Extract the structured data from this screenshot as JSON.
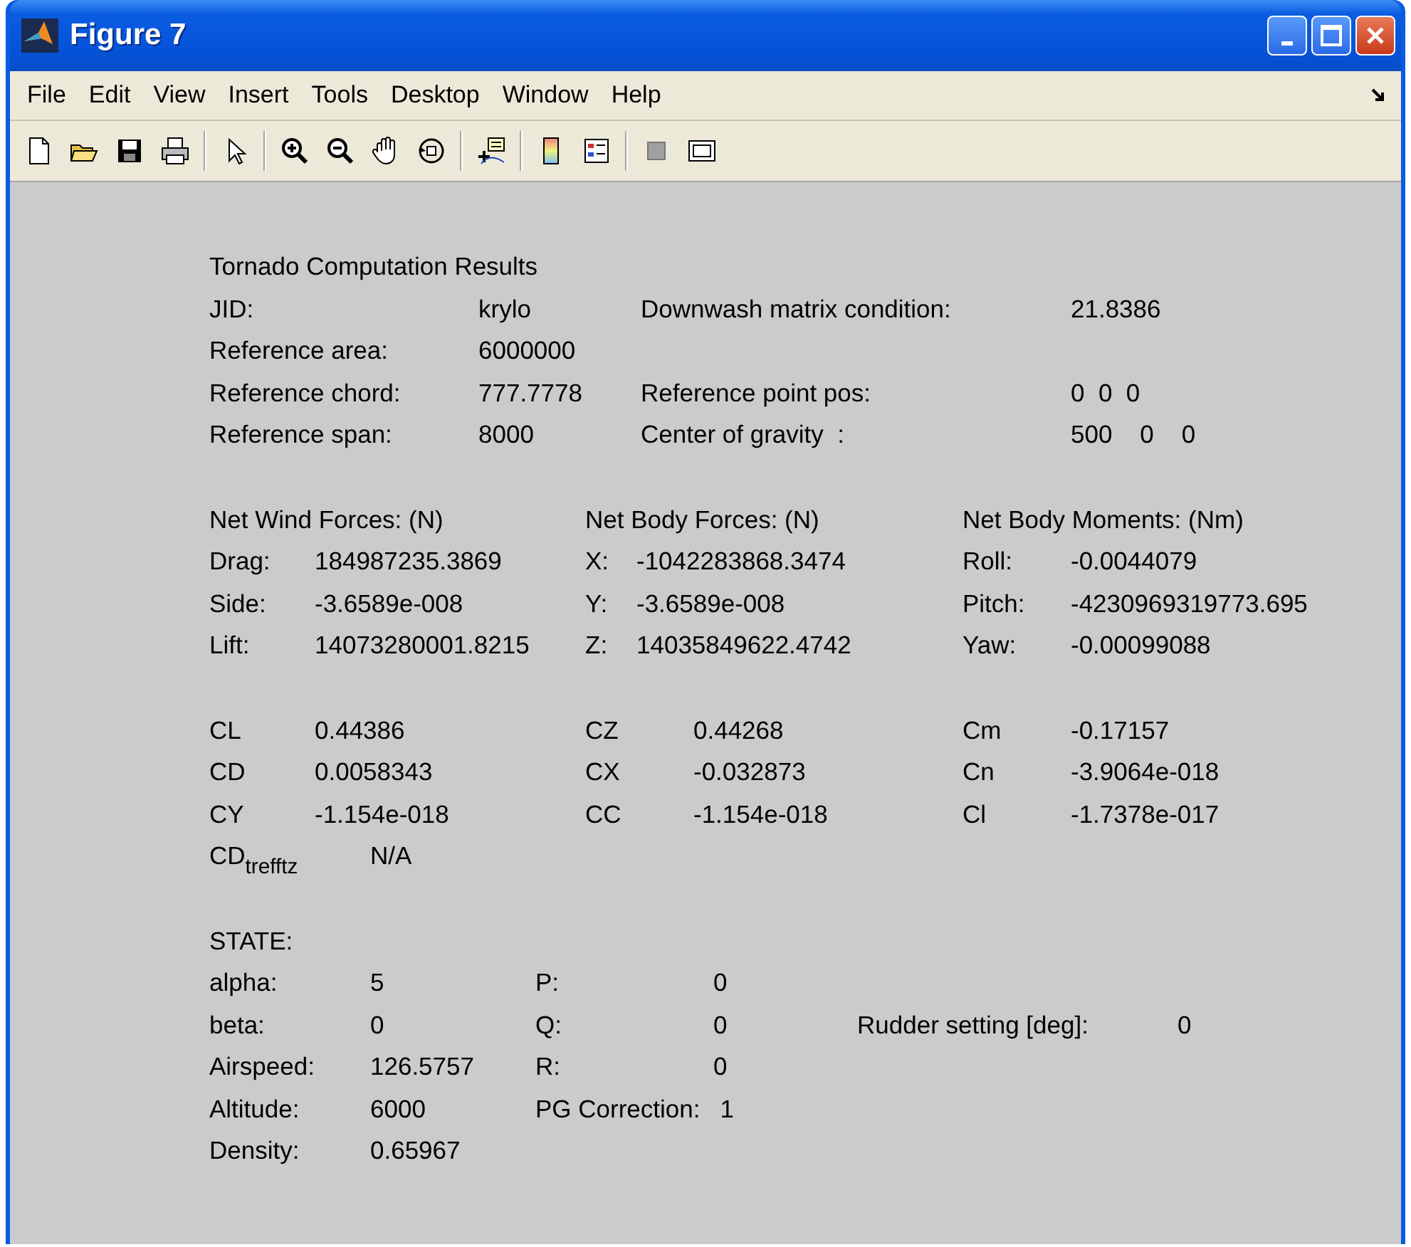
{
  "window": {
    "title": "Figure 7"
  },
  "menu": [
    "File",
    "Edit",
    "View",
    "Insert",
    "Tools",
    "Desktop",
    "Window",
    "Help"
  ],
  "summary": {
    "title": "Tornado Computation Results",
    "rows": [
      {
        "label": "JID:",
        "value": "krylo",
        "label_2": "Downwash matrix condition:",
        "value_2": "21.8386"
      },
      {
        "label": "Reference area:",
        "value": "6000000"
      },
      {
        "label": "Reference chord:",
        "value": "777.7778",
        "label_2": "Reference point pos:",
        "value_2": "0  0  0"
      },
      {
        "label": "Reference span:",
        "value": "8000",
        "label_2": "Center of gravity  :",
        "value_2": "500    0    0"
      }
    ]
  },
  "forces": {
    "headings": [
      "Net Wind Forces: (N)",
      "Net Body Forces: (N)",
      "Net Body Moments: (Nm)"
    ],
    "rows": [
      [
        {
          "label": "Drag:",
          "value": "184987235.3869"
        },
        {
          "label": "X:",
          "value": "-1042283868.3474"
        },
        {
          "label": "Roll:",
          "value": "-0.0044079"
        }
      ],
      [
        {
          "label": "Side:",
          "value": "-3.6589e-008"
        },
        {
          "label": "Y:",
          "value": "-3.6589e-008"
        },
        {
          "label": "Pitch:",
          "value": "-4230969319773.695"
        }
      ],
      [
        {
          "label": "Lift:",
          "value": "14073280001.8215"
        },
        {
          "label": "Z:",
          "value": "14035849622.4742"
        },
        {
          "label": "Yaw:",
          "value": "-0.00099088"
        }
      ]
    ]
  },
  "coefficients": {
    "rows": [
      [
        {
          "label": "CL",
          "value": "0.44386"
        },
        {
          "label": "CZ",
          "value": "0.44268"
        },
        {
          "label": "Cm",
          "value": "-0.17157"
        }
      ],
      [
        {
          "label": "CD",
          "value": "0.0058343"
        },
        {
          "label": "CX",
          "value": "-0.032873"
        },
        {
          "label": "Cn",
          "value": "-3.9064e-018"
        }
      ],
      [
        {
          "label": "CY",
          "value": "-1.154e-018"
        },
        {
          "label": "CC",
          "value": "-1.154e-018"
        },
        {
          "label": "Cl",
          "value": "-1.7378e-017"
        }
      ]
    ],
    "trefftz": {
      "label": "CD$_{trefftz}$",
      "value": "N/A"
    }
  },
  "state": {
    "title": "STATE:",
    "rows": [
      [
        {
          "label": "alpha:",
          "value": "5"
        },
        {
          "label": "P:",
          "value": "0"
        }
      ],
      [
        {
          "label": "beta:",
          "value": "0"
        },
        {
          "label": "Q:",
          "value": "0"
        },
        {
          "label": "Rudder setting [deg]:",
          "value": "0"
        }
      ],
      [
        {
          "label": "Airspeed:",
          "value": "126.5757"
        },
        {
          "label": "R:",
          "value": "0"
        }
      ],
      [
        {
          "label": "Altitude:",
          "value": "6000"
        },
        {
          "label": "PG Correction:",
          "value": "1"
        }
      ],
      [
        {
          "label": "Density:",
          "value": "0.65967"
        }
      ]
    ]
  }
}
